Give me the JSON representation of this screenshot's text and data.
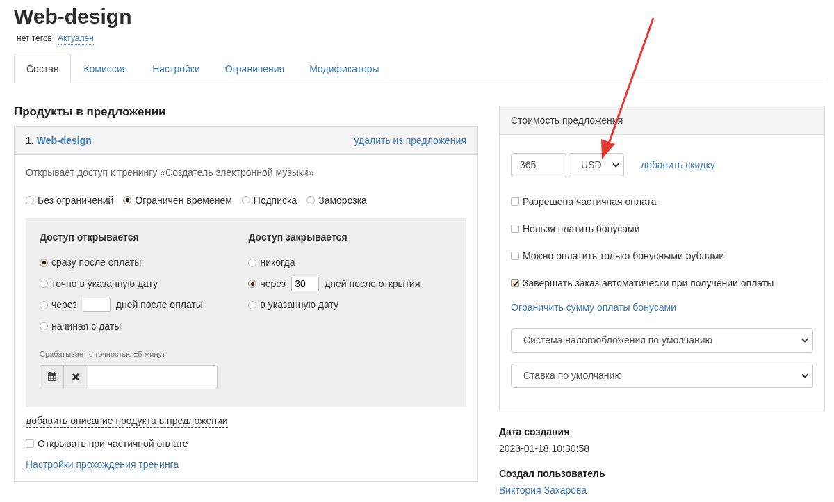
{
  "title": "Web-design",
  "tags": {
    "label": "нет тегов",
    "status": "Актуален"
  },
  "tabs": [
    {
      "label": "Состав",
      "selected": true
    },
    {
      "label": "Комиссия",
      "selected": false
    },
    {
      "label": "Настройки",
      "selected": false
    },
    {
      "label": "Ограничения",
      "selected": false
    },
    {
      "label": "Модификаторы",
      "selected": false
    }
  ],
  "products_heading": "Продукты в предложении",
  "product": {
    "number": "1.",
    "name": "Web-design",
    "remove": "удалить из предложения",
    "description": "Открывает доступ к тренингу «Создатель электронной музыки»",
    "access_types": [
      {
        "label": "Без ограничений",
        "selected": false
      },
      {
        "label": "Ограничен временем",
        "selected": true
      },
      {
        "label": "Подписка",
        "selected": false
      },
      {
        "label": "Заморозка",
        "selected": false
      }
    ],
    "open": {
      "heading": "Доступ открывается",
      "options": [
        {
          "kind": "plain",
          "label": "сразу после оплаты",
          "selected": true
        },
        {
          "kind": "plain",
          "label": "точно в указанную дату",
          "selected": false
        },
        {
          "kind": "days",
          "before": "через",
          "after": "дней после оплаты",
          "selected": false
        },
        {
          "kind": "plain",
          "label": "начиная с даты",
          "selected": false
        }
      ],
      "note": "Срабатывает с точностью ±5 минут"
    },
    "close": {
      "heading": "Доступ закрывается",
      "options": [
        {
          "kind": "plain",
          "label": "никогда",
          "selected": false
        },
        {
          "kind": "days",
          "before": "через",
          "value": "30",
          "after": "дней после открытия",
          "selected": true
        },
        {
          "kind": "plain",
          "label": "в указанную дату",
          "selected": false
        }
      ]
    },
    "add_description": "добавить описание продукта в предложении",
    "partial_open": {
      "label": "Открывать при частичной оплате",
      "checked": false
    },
    "training_settings": "Настройки прохождения тренинга"
  },
  "price": {
    "title": "Стоимость предложения",
    "amount": "365",
    "currency": "USD",
    "add_discount": "добавить скидку",
    "options": [
      {
        "label": "Разрешена частичная оплата",
        "checked": false
      },
      {
        "label": "Нельзя платить бонусами",
        "checked": false
      },
      {
        "label": "Можно оплатить только бонусными рублями",
        "checked": false
      },
      {
        "label": "Завершать заказ автоматически при получении оплаты",
        "checked": true
      }
    ],
    "limit_bonus": "Ограничить сумму оплаты бонусами",
    "tax_system": "Система налогообложения по умолчанию",
    "tax_rate": "Ставка по умолчанию"
  },
  "created": {
    "label": "Дата создания",
    "value": "2023-01-18 10:30:58"
  },
  "creator": {
    "label": "Создал пользователь",
    "value": "Виктория Захарова"
  }
}
